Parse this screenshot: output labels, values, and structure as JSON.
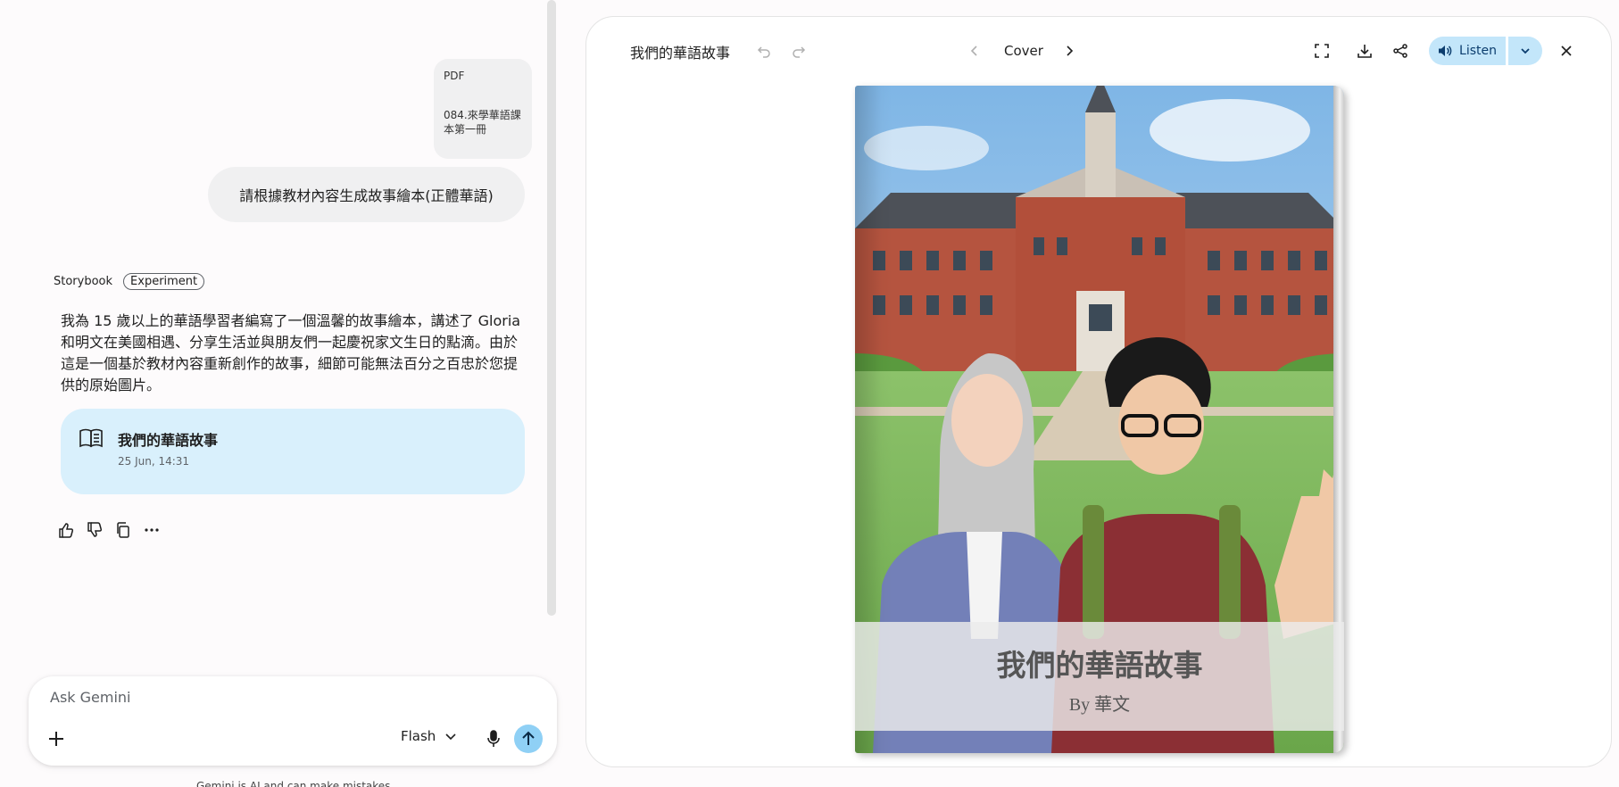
{
  "chat": {
    "attachment": {
      "type": "PDF",
      "name": "084.來學華語課本第一冊"
    },
    "user_message": "請根據教材內容生成故事繪本(正體華語)",
    "model_label": "Storybook",
    "model_badge": "Experiment",
    "response": "我為 15 歲以上的華語學習者編寫了一個溫馨的故事繪本，講述了 Gloria 和明文在美國相遇、分享生活並與朋友們一起慶祝家文生日的點滴。由於這是一個基於教材內容重新創作的故事，細節可能無法百分之百忠於您提供的原始圖片。",
    "story_card": {
      "title": "我們的華語故事",
      "date": "25 Jun, 14:31"
    },
    "input": {
      "placeholder": "Ask Gemini",
      "model": "Flash"
    },
    "disclaimer": "Gemini is AI and can make mistakes"
  },
  "panel": {
    "title": "我們的華語故事",
    "page": "Cover",
    "listen_label": "Listen",
    "cover": {
      "title": "我們的華語故事",
      "author": "By 華文"
    }
  },
  "colors": {
    "card_bg": "#d9f0fc",
    "listen_bg": "#c3e6fa",
    "send_bg": "#8fd0f5"
  }
}
